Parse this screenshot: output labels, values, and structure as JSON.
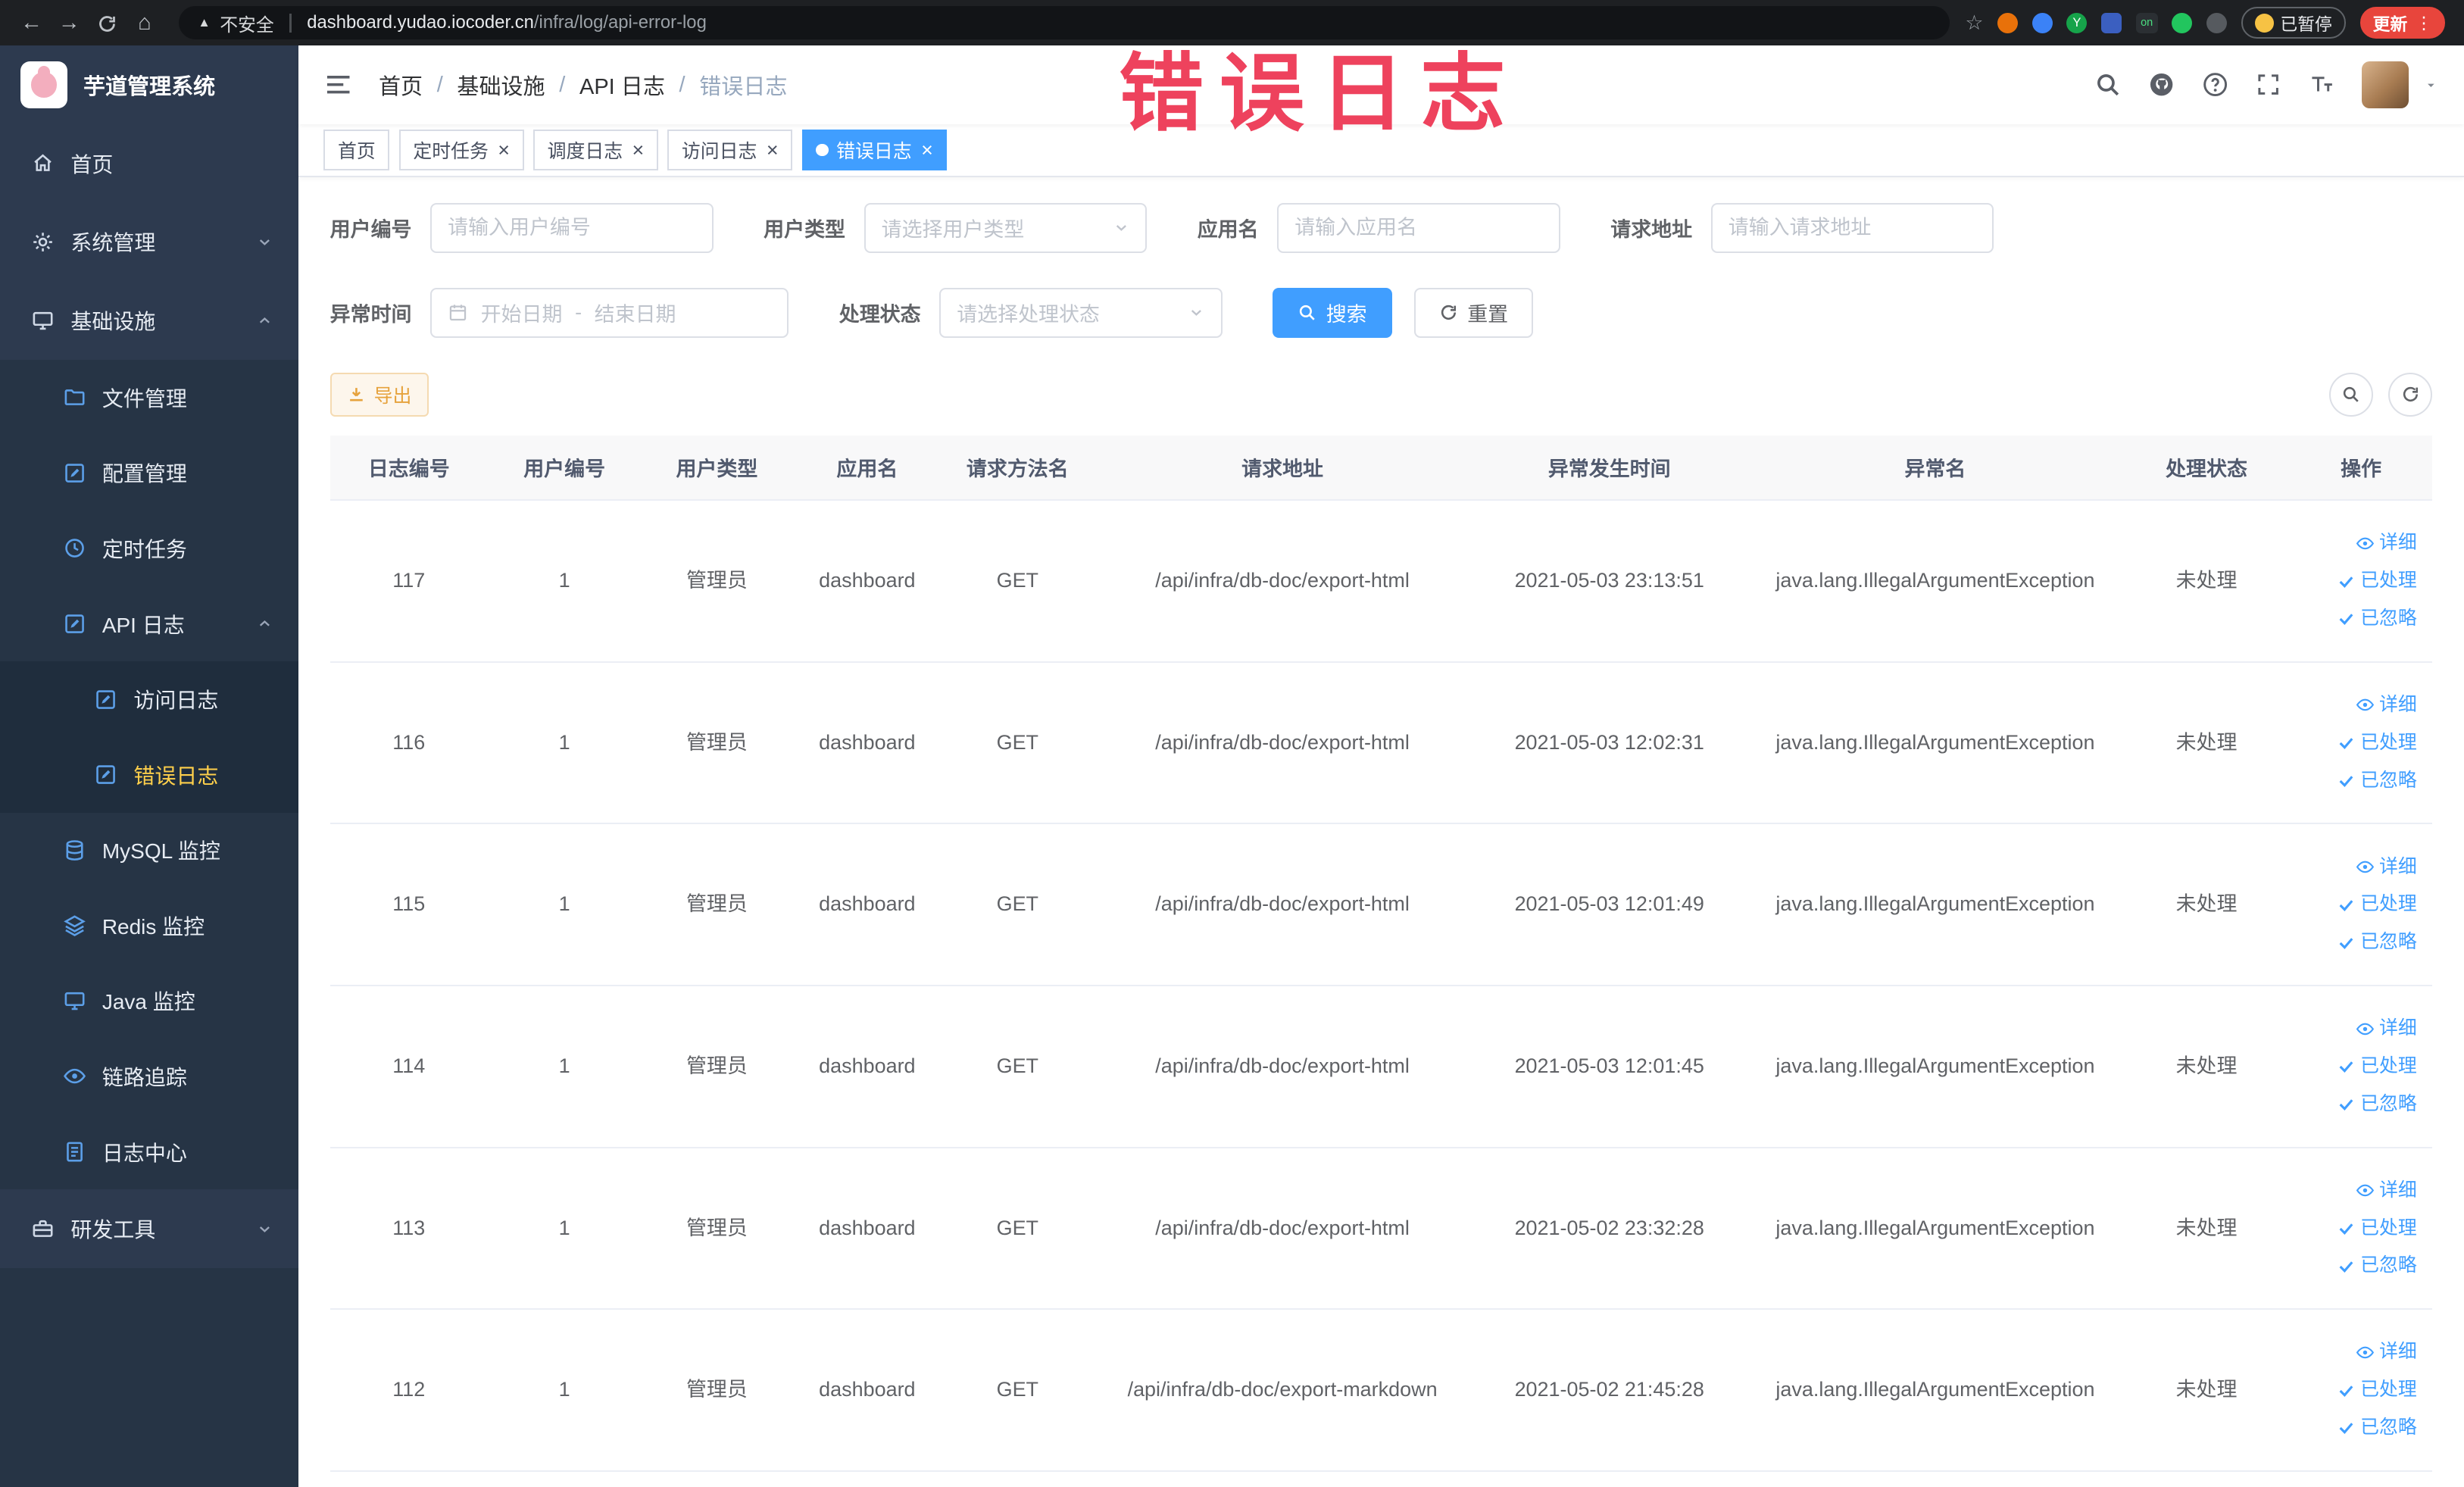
{
  "colors": {
    "accent": "#409eff",
    "sidebar_bg": "#2d3a4f",
    "active_menu_text": "#ffd04b",
    "export_text": "#e6a23c",
    "update_button": "#e8453c",
    "annotation": "#ed3350"
  },
  "browser": {
    "security_label": "不安全",
    "url_domain": "dashboard.yudao.iocoder.cn",
    "url_path": "/infra/log/api-error-log",
    "paused_label": "已暂停",
    "update_label": "更新"
  },
  "annotation": {
    "text": "错误日志"
  },
  "sidebar": {
    "logo_title": "芋道管理系统",
    "items": [
      {
        "key": "home",
        "label": "首页",
        "icon": "home-icon",
        "level": 1
      },
      {
        "key": "system-management",
        "label": "系统管理",
        "icon": "gear-icon",
        "level": 1,
        "chevron": "down"
      },
      {
        "key": "infrastructure",
        "label": "基础设施",
        "icon": "monitor-icon",
        "level": 1,
        "chevron": "up"
      },
      {
        "key": "file-management",
        "label": "文件管理",
        "icon": "folder-icon",
        "level": 2
      },
      {
        "key": "config-management",
        "label": "配置管理",
        "icon": "edit-icon",
        "level": 2
      },
      {
        "key": "scheduled-tasks",
        "label": "定时任务",
        "icon": "clock-icon",
        "level": 2
      },
      {
        "key": "api-log",
        "label": "API 日志",
        "icon": "log-icon",
        "level": 2,
        "chevron": "up"
      },
      {
        "key": "access-log",
        "label": "访问日志",
        "icon": "log-icon",
        "level": 3
      },
      {
        "key": "error-log",
        "label": "错误日志",
        "icon": "log-icon",
        "level": 3,
        "active": true
      },
      {
        "key": "mysql-monitor",
        "label": "MySQL 监控",
        "icon": "database-icon",
        "level": 2
      },
      {
        "key": "redis-monitor",
        "label": "Redis 监控",
        "icon": "layers-icon",
        "level": 2
      },
      {
        "key": "java-monitor",
        "label": "Java 监控",
        "icon": "display-icon",
        "level": 2
      },
      {
        "key": "tracing",
        "label": "链路追踪",
        "icon": "eye-icon",
        "level": 2
      },
      {
        "key": "log-center",
        "label": "日志中心",
        "icon": "doc-icon",
        "level": 2
      },
      {
        "key": "dev-tools",
        "label": "研发工具",
        "icon": "toolbox-icon",
        "level": 1,
        "chevron": "down"
      }
    ]
  },
  "header": {
    "breadcrumbs": [
      "首页",
      "基础设施",
      "API 日志",
      "错误日志"
    ]
  },
  "tabs": [
    {
      "key": "home",
      "label": "首页",
      "active": false,
      "closable": false
    },
    {
      "key": "scheduled-tasks",
      "label": "定时任务",
      "active": false,
      "closable": true
    },
    {
      "key": "dispatch-log",
      "label": "调度日志",
      "active": false,
      "closable": true
    },
    {
      "key": "access-log",
      "label": "访问日志",
      "active": false,
      "closable": true
    },
    {
      "key": "error-log",
      "label": "错误日志",
      "active": true,
      "closable": true
    }
  ],
  "filters": {
    "user_id_label": "用户编号",
    "user_id_placeholder": "请输入用户编号",
    "user_type_label": "用户类型",
    "user_type_placeholder": "请选择用户类型",
    "app_name_label": "应用名",
    "app_name_placeholder": "请输入应用名",
    "request_url_label": "请求地址",
    "request_url_placeholder": "请输入请求地址",
    "exception_time_label": "异常时间",
    "date_start_placeholder": "开始日期",
    "date_separator": "-",
    "date_end_placeholder": "结束日期",
    "process_status_label": "处理状态",
    "process_status_placeholder": "请选择处理状态",
    "search_label": "搜索",
    "reset_label": "重置"
  },
  "toolbar": {
    "export_label": "导出"
  },
  "table": {
    "columns": [
      "日志编号",
      "用户编号",
      "用户类型",
      "应用名",
      "请求方法名",
      "请求地址",
      "异常发生时间",
      "异常名",
      "处理状态",
      "操作"
    ],
    "column_keys": [
      "log-id",
      "user-id",
      "user-type",
      "app-name",
      "request-method",
      "request-url",
      "exception-time",
      "exception-name",
      "process-status",
      "actions"
    ],
    "action_labels": [
      "详细",
      "已处理",
      "已忽略"
    ],
    "rows": [
      {
        "id": "117",
        "user_id": "1",
        "user_type": "管理员",
        "app": "dashboard",
        "method": "GET",
        "url": "/api/infra/db-doc/export-html",
        "time": "2021-05-03 23:13:51",
        "exception": "java.lang.IllegalArgumentException",
        "status": "未处理"
      },
      {
        "id": "116",
        "user_id": "1",
        "user_type": "管理员",
        "app": "dashboard",
        "method": "GET",
        "url": "/api/infra/db-doc/export-html",
        "time": "2021-05-03 12:02:31",
        "exception": "java.lang.IllegalArgumentException",
        "status": "未处理"
      },
      {
        "id": "115",
        "user_id": "1",
        "user_type": "管理员",
        "app": "dashboard",
        "method": "GET",
        "url": "/api/infra/db-doc/export-html",
        "time": "2021-05-03 12:01:49",
        "exception": "java.lang.IllegalArgumentException",
        "status": "未处理"
      },
      {
        "id": "114",
        "user_id": "1",
        "user_type": "管理员",
        "app": "dashboard",
        "method": "GET",
        "url": "/api/infra/db-doc/export-html",
        "time": "2021-05-03 12:01:45",
        "exception": "java.lang.IllegalArgumentException",
        "status": "未处理"
      },
      {
        "id": "113",
        "user_id": "1",
        "user_type": "管理员",
        "app": "dashboard",
        "method": "GET",
        "url": "/api/infra/db-doc/export-html",
        "time": "2021-05-02 23:32:28",
        "exception": "java.lang.IllegalArgumentException",
        "status": "未处理"
      },
      {
        "id": "112",
        "user_id": "1",
        "user_type": "管理员",
        "app": "dashboard",
        "method": "GET",
        "url": "/api/infra/db-doc/export-markdown",
        "time": "2021-05-02 21:45:28",
        "exception": "java.lang.IllegalArgumentException",
        "status": "未处理"
      }
    ]
  }
}
